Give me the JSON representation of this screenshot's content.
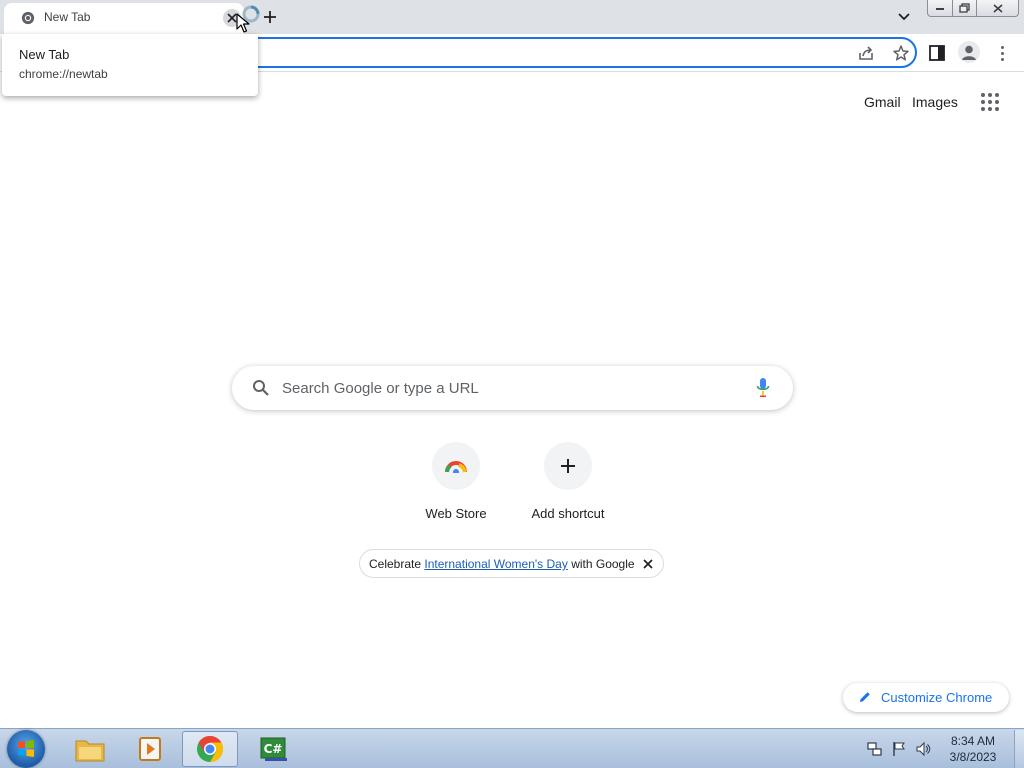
{
  "browser": {
    "tab": {
      "title": "New Tab"
    },
    "hover_card": {
      "title": "New Tab",
      "url": "chrome://newtab"
    }
  },
  "ntp": {
    "header_links": {
      "gmail": "Gmail",
      "images": "Images"
    },
    "search": {
      "placeholder": "Search Google or type a URL"
    },
    "shortcuts": [
      {
        "label": "Web Store"
      },
      {
        "label": "Add shortcut"
      }
    ],
    "promo": {
      "prefix": "Celebrate ",
      "link": "International Women's Day",
      "suffix": " with Google"
    },
    "customize_label": "Customize Chrome"
  },
  "taskbar": {
    "clock": {
      "time": "8:34 AM",
      "date": "3/8/2023"
    }
  },
  "colors": {
    "accent_blue": "#1a73e8",
    "tab_strip": "#dee1e6",
    "taskbar": "#b6c9e2",
    "google_red": "#ea4335",
    "google_yellow": "#fbbc05",
    "google_green": "#34a853",
    "google_blue": "#4285f4"
  }
}
